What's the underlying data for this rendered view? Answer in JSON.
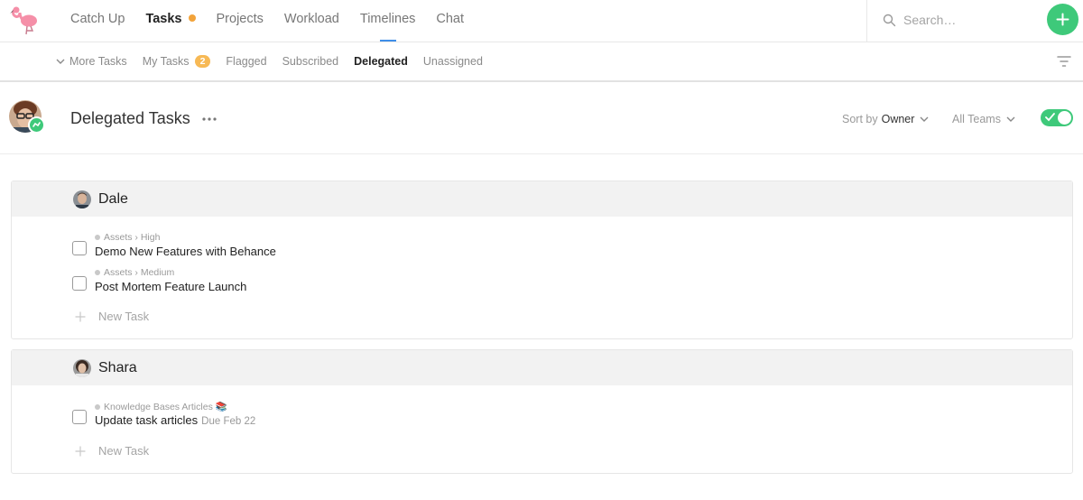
{
  "app": {
    "colors": {
      "accent": "#3ec97a",
      "badge": "#f7b955",
      "unread_dot": "#f2a33a",
      "active_underline": "#3f8ee8"
    }
  },
  "main_nav": {
    "items": [
      {
        "label": "Catch Up"
      },
      {
        "label": "Tasks",
        "active": true,
        "has_dot": true
      },
      {
        "label": "Projects"
      },
      {
        "label": "Workload"
      },
      {
        "label": "Timelines",
        "underline": true
      },
      {
        "label": "Chat"
      }
    ]
  },
  "search": {
    "placeholder": "Search…",
    "icon": "search-icon"
  },
  "add_button": {
    "icon": "plus-icon"
  },
  "sub_nav": {
    "items": [
      {
        "label": "More Tasks",
        "icon": "chevron-down-icon"
      },
      {
        "label": "My Tasks",
        "badge": "2"
      },
      {
        "label": "Flagged"
      },
      {
        "label": "Subscribed"
      },
      {
        "label": "Delegated",
        "active": true
      },
      {
        "label": "Unassigned"
      }
    ],
    "filter_icon": "filter-icon"
  },
  "page": {
    "title": "Delegated Tasks",
    "sort": {
      "prefix": "Sort by",
      "value": "Owner"
    },
    "teams": {
      "label": "All Teams"
    },
    "toggle": {
      "on": true
    }
  },
  "groups": [
    {
      "owner": "Dale",
      "tasks": [
        {
          "meta": "Assets › High",
          "title": "Demo New Features with Behance",
          "due": ""
        },
        {
          "meta": "Assets › Medium",
          "title": "Post Mortem Feature Launch",
          "due": ""
        }
      ],
      "new_task_label": "New Task"
    },
    {
      "owner": "Shara",
      "tasks": [
        {
          "meta": "Knowledge Bases Articles",
          "title": "Update task articles",
          "due": "Due Feb 22",
          "emoji": "📚"
        }
      ],
      "new_task_label": "New Task"
    }
  ]
}
